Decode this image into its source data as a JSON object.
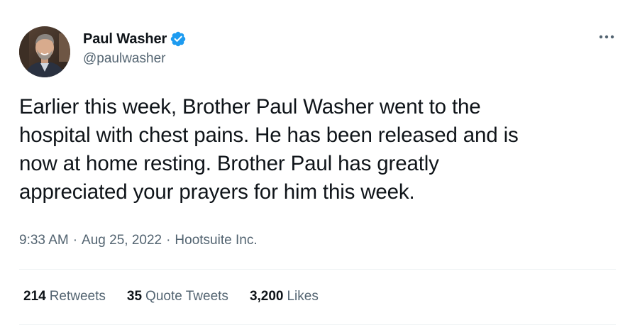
{
  "author": {
    "display_name": "Paul Washer",
    "handle": "@paulwasher",
    "verified": true
  },
  "tweet": {
    "text": "Earlier this week, Brother Paul Washer went to the\nhospital with chest pains. He has been released and is\nnow at home resting. Brother Paul has greatly\nappreciated your prayers for him this week.",
    "time": "9:33 AM",
    "date": "Aug 25, 2022",
    "source": "Hootsuite Inc.",
    "separator": "·"
  },
  "stats": {
    "retweets": {
      "count": "214",
      "label": "Retweets"
    },
    "quote_tweets": {
      "count": "35",
      "label": "Quote Tweets"
    },
    "likes": {
      "count": "3,200",
      "label": "Likes"
    }
  },
  "colors": {
    "verified_blue": "#1d9bf0",
    "secondary_text": "#536471",
    "primary_text": "#0f1419",
    "divider": "#eff3f4"
  },
  "icons": {
    "more": "more-horizontal-icon",
    "verified": "verified-badge-icon"
  }
}
